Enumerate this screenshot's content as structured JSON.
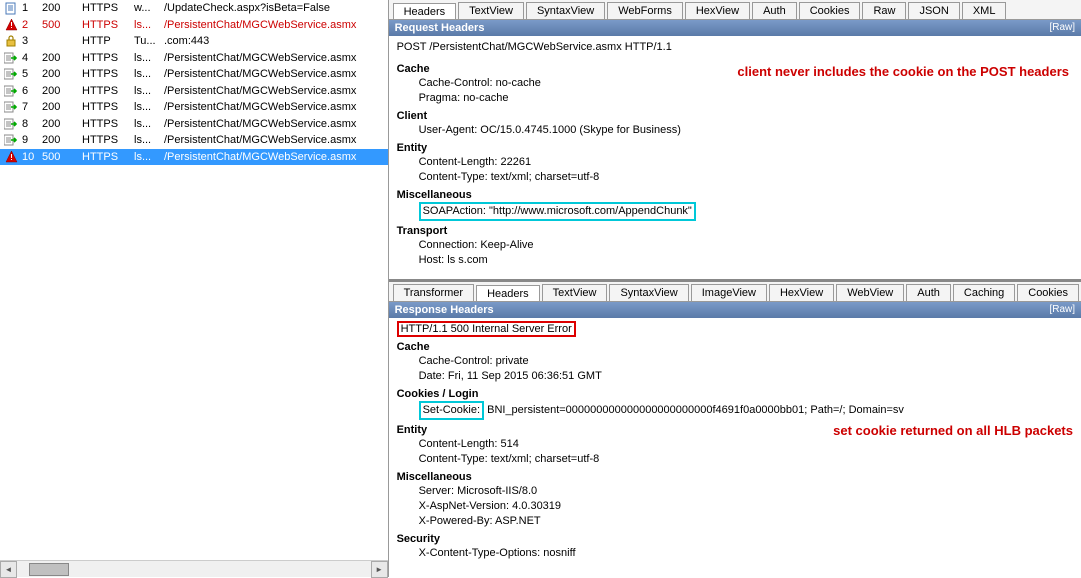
{
  "sessions": [
    {
      "n": "1",
      "status": "200",
      "proto": "HTTPS",
      "host": "w...",
      "url": "/UpdateCheck.aspx?isBeta=False",
      "icon": "doc",
      "red": false
    },
    {
      "n": "2",
      "status": "500",
      "proto": "HTTPS",
      "host": "ls...",
      "url": "/PersistentChat/MGCWebService.asmx",
      "icon": "warn",
      "red": true
    },
    {
      "n": "3",
      "status": "",
      "proto": "HTTP",
      "host": "Tu...",
      "url": ".com:443",
      "icon": "lock",
      "red": false
    },
    {
      "n": "4",
      "status": "200",
      "proto": "HTTPS",
      "host": "ls...",
      "url": "/PersistentChat/MGCWebService.asmx",
      "icon": "send",
      "red": false
    },
    {
      "n": "5",
      "status": "200",
      "proto": "HTTPS",
      "host": "ls...",
      "url": "/PersistentChat/MGCWebService.asmx",
      "icon": "send",
      "red": false
    },
    {
      "n": "6",
      "status": "200",
      "proto": "HTTPS",
      "host": "ls...",
      "url": "/PersistentChat/MGCWebService.asmx",
      "icon": "send",
      "red": false
    },
    {
      "n": "7",
      "status": "200",
      "proto": "HTTPS",
      "host": "ls...",
      "url": "/PersistentChat/MGCWebService.asmx",
      "icon": "send",
      "red": false
    },
    {
      "n": "8",
      "status": "200",
      "proto": "HTTPS",
      "host": "ls...",
      "url": "/PersistentChat/MGCWebService.asmx",
      "icon": "send",
      "red": false
    },
    {
      "n": "9",
      "status": "200",
      "proto": "HTTPS",
      "host": "ls...",
      "url": "/PersistentChat/MGCWebService.asmx",
      "icon": "send",
      "red": false
    },
    {
      "n": "10",
      "status": "500",
      "proto": "HTTPS",
      "host": "ls...",
      "url": "/PersistentChat/MGCWebService.asmx",
      "icon": "warn",
      "red": true,
      "selected": true
    }
  ],
  "req_tabs": [
    "Headers",
    "TextView",
    "SyntaxView",
    "WebForms",
    "HexView",
    "Auth",
    "Cookies",
    "Raw",
    "JSON",
    "XML"
  ],
  "resp_tabs": [
    "Transformer",
    "Headers",
    "TextView",
    "SyntaxView",
    "ImageView",
    "HexView",
    "WebView",
    "Auth",
    "Caching",
    "Cookies"
  ],
  "req_section_title": "Request Headers",
  "resp_section_title": "Response Headers",
  "raw_label": "[Raw]",
  "request_line": "POST /PersistentChat/MGCWebService.asmx HTTP/1.1",
  "req_groups": [
    {
      "title": "Cache",
      "lines": [
        "Cache-Control: no-cache",
        "Pragma: no-cache"
      ]
    },
    {
      "title": "Client",
      "lines": [
        "User-Agent: OC/15.0.4745.1000 (Skype for Business)"
      ]
    },
    {
      "title": "Entity",
      "lines": [
        "Content-Length: 22261",
        "Content-Type: text/xml; charset=utf-8"
      ]
    },
    {
      "title": "Miscellaneous",
      "lines": [],
      "boxed": "SOAPAction: \"http://www.microsoft.com/AppendChunk\""
    },
    {
      "title": "Transport",
      "lines": [
        "Connection: Keep-Alive",
        "Host: ls                                   s.com"
      ]
    }
  ],
  "response_line": "HTTP/1.1 500 Internal Server Error",
  "resp_groups": [
    {
      "title": "Cache",
      "lines": [
        "Cache-Control: private",
        "Date: Fri, 11 Sep 2015 06:36:51 GMT"
      ]
    },
    {
      "title": "Cookies / Login",
      "lines": [],
      "cookie_key": "Set-Cookie:",
      "cookie_val": " BNI_persistent=000000000000000000000000f4691f0a0000bb01; Path=/; Domain=sv"
    },
    {
      "title": "Entity",
      "lines": [
        "Content-Length: 514",
        "Content-Type: text/xml; charset=utf-8"
      ]
    },
    {
      "title": "Miscellaneous",
      "lines": [
        "Server: Microsoft-IIS/8.0",
        "X-AspNet-Version: 4.0.30319",
        "X-Powered-By: ASP.NET"
      ]
    },
    {
      "title": "Security",
      "lines": [
        "X-Content-Type-Options: nosniff"
      ]
    }
  ],
  "annot1": "client never includes the cookie on the POST headers",
  "annot2": "set cookie returned on all HLB packets"
}
